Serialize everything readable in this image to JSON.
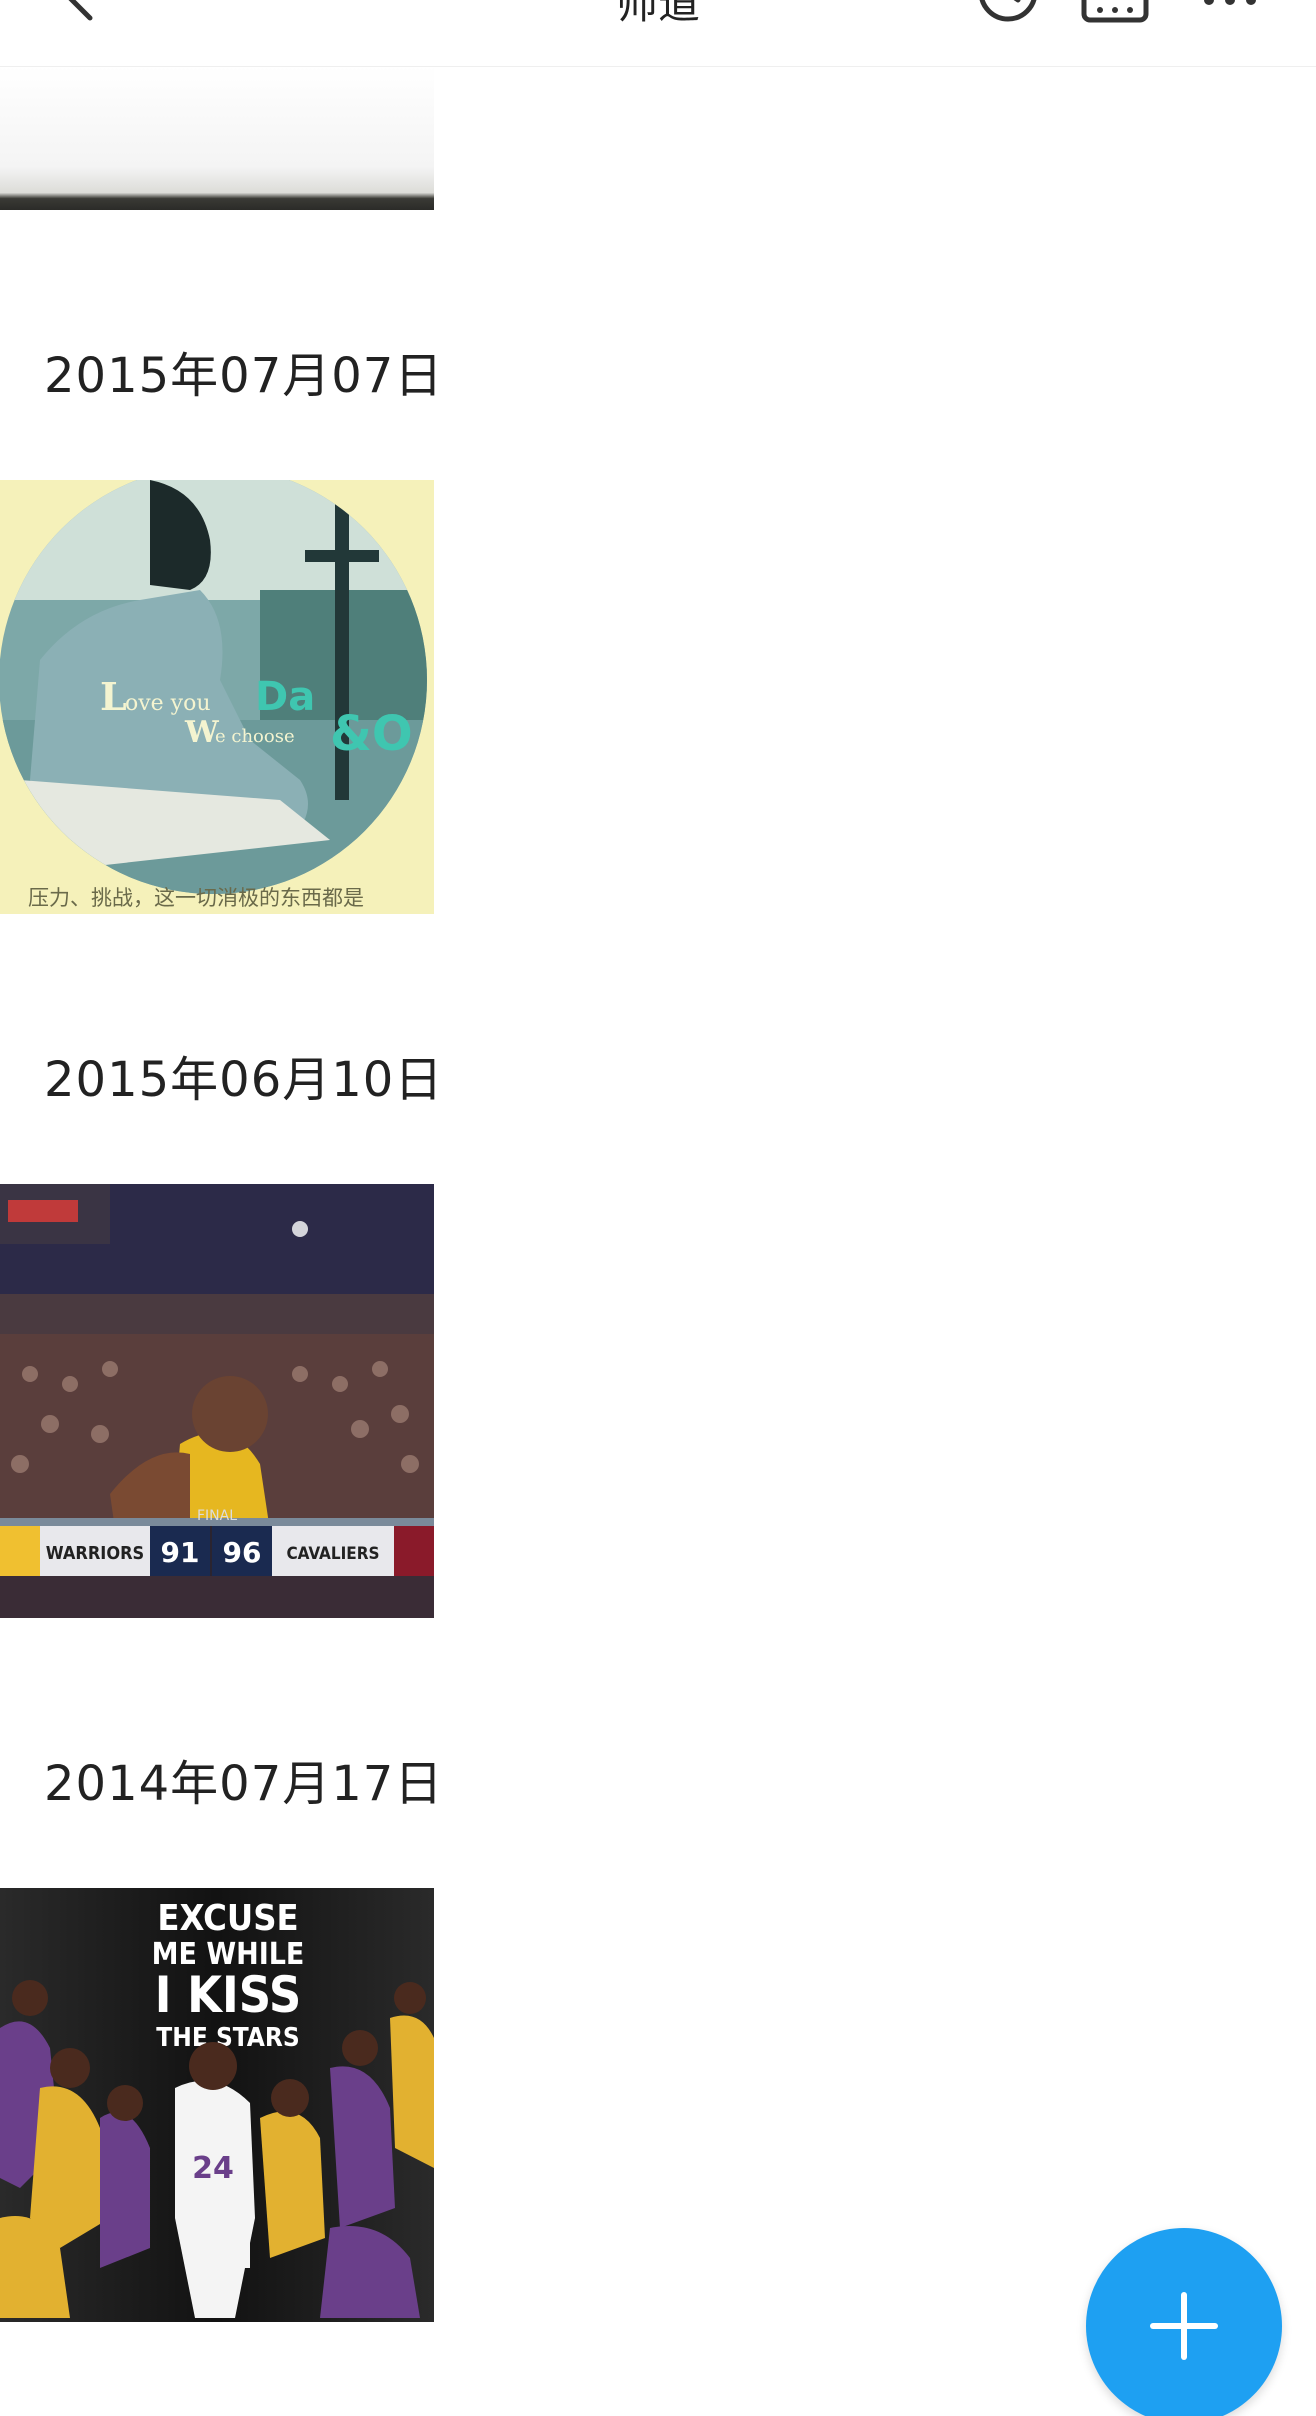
{
  "topbar": {
    "title": "师道",
    "back_icon": "back-arrow-icon",
    "icons": [
      "clock-icon",
      "album-icon",
      "more-icon"
    ]
  },
  "feed": {
    "entries": [
      {
        "date": "2015年07月07日",
        "photo": {
          "overlay_text": "Love you We choose",
          "caption": "压力、挑战，这一切消极的东西都是"
        }
      },
      {
        "date": "2015年06月10日",
        "photo": {
          "scoreboard": {
            "status": "FINAL",
            "home": "WARRIORS",
            "home_score": "91",
            "away_score": "96",
            "away": "CAVALIERS"
          }
        }
      },
      {
        "date": "2014年07月17日",
        "photo": {
          "poster_lines": [
            "EXCUSE",
            "ME WHILE",
            "I KISS",
            "THE STARS"
          ],
          "jersey_number": "24"
        }
      }
    ]
  },
  "fab": {
    "icon": "plus-icon",
    "color": "#1ea0f2"
  }
}
